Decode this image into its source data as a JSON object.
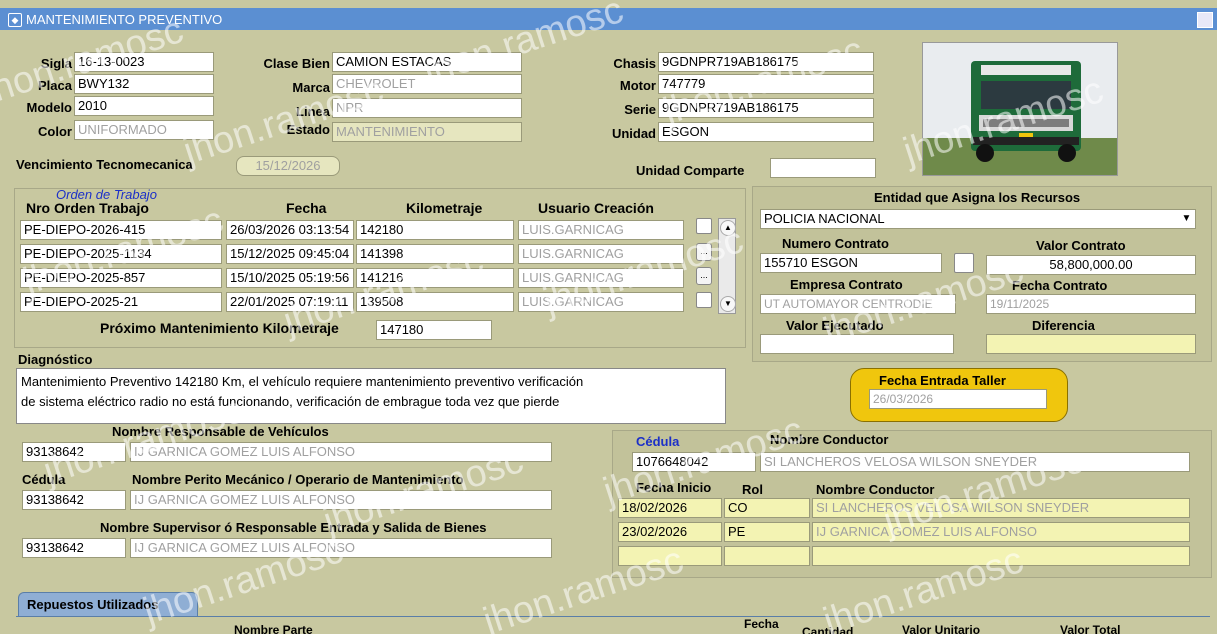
{
  "window": {
    "title": "MANTENIMIENTO PREVENTIVO"
  },
  "vehicle": {
    "sigla_label": "Sigla",
    "sigla": "16-13-0023",
    "placa_label": "Placa",
    "placa": "BWY132",
    "modelo_label": "Modelo",
    "modelo": "2010",
    "color_label": "Color",
    "color": "UNIFORMADO",
    "clase_label": "Clase Bien",
    "clase": "CAMION ESTACAS",
    "marca_label": "Marca",
    "marca": "CHEVROLET",
    "linea_label": "Linea",
    "linea": "NPR",
    "estado_label": "Estado",
    "estado": "MANTENIMIENTO",
    "chasis_label": "Chasis",
    "chasis": "9GDNPR719AB186175",
    "motor_label": "Motor",
    "motor": "747779",
    "serie_label": "Serie",
    "serie": "9GDNPR719AB186175",
    "unidad_label": "Unidad",
    "unidad": "ESGON",
    "tecno_label": "Vencimiento Tecnomecanica",
    "tecno": "15/12/2026",
    "comparte_label": "Unidad Comparte",
    "comparte": ""
  },
  "orders": {
    "section_title": "Orden de Trabajo",
    "headers": [
      "Nro Orden Trabajo",
      "Fecha",
      "Kilometraje",
      "Usuario Creación"
    ],
    "rows": [
      {
        "nro": "PE-DIEPO-2026-415",
        "fecha": "26/03/2026 03:13:54",
        "km": "142180",
        "usuario": "LUIS.GARNICAG"
      },
      {
        "nro": "PE-DIEPO-2025-1134",
        "fecha": "15/12/2025 09:45:04",
        "km": "141398",
        "usuario": "LUIS.GARNICAG"
      },
      {
        "nro": "PE-DIEPO-2025-857",
        "fecha": "15/10/2025 05:19:56",
        "km": "141216",
        "usuario": "LUIS.GARNICAG"
      },
      {
        "nro": "PE-DIEPO-2025-21",
        "fecha": "22/01/2025 07:19:11",
        "km": "139508",
        "usuario": "LUIS.GARNICAG"
      }
    ],
    "proximo_label": "Próximo Mantenimiento Kilometraje",
    "proximo": "147180"
  },
  "entidad": {
    "title": "Entidad que Asigna los Recursos",
    "value": "POLICIA NACIONAL",
    "numero_label": "Numero Contrato",
    "numero": "155710 ESGON",
    "valor_label": "Valor Contrato",
    "valor": "58,800,000.00",
    "empresa_label": "Empresa Contrato",
    "empresa": "UT AUTOMAYOR CENTRODIE",
    "fecha_label": "Fecha Contrato",
    "fecha": "19/11/2025",
    "ejecutado_label": "Valor Ejecutado",
    "ejecutado": "",
    "diferencia_label": "Diferencia",
    "diferencia": ""
  },
  "diagnostico": {
    "label": "Diagnóstico",
    "line1": "Mantenimiento Preventivo 142180 Km, el vehículo requiere mantenimiento preventivo verificación",
    "line2": "de sistema eléctrico radio no está funcionando, verificación de embrague toda vez que pierde"
  },
  "taller": {
    "label": "Fecha Entrada Taller",
    "value": "26/03/2026"
  },
  "responsables": {
    "resp_title": "Nombre Responsable de Vehículos",
    "resp_id": "93138642",
    "resp_name": "IJ GARNICA GOMEZ LUIS ALFONSO",
    "cedula_label": "Cédula",
    "perito_title": "Nombre Perito Mecánico / Operario de Mantenimiento",
    "perito_id": "93138642",
    "perito_name": "IJ GARNICA GOMEZ LUIS ALFONSO",
    "super_title": "Nombre Supervisor ó Responsable Entrada y Salida de Bienes",
    "super_id": "93138642",
    "super_name": "IJ GARNICA GOMEZ LUIS ALFONSO"
  },
  "conductor": {
    "cedula_label": "Cédula",
    "nombre_label": "Nombre Conductor",
    "cedula": "1076648042",
    "nombre": "SI LANCHEROS VELOSA WILSON SNEYDER",
    "hdr_inicio": "Fecha Inicio",
    "hdr_rol": "Rol",
    "hdr_nombre": "Nombre Conductor",
    "rows": [
      {
        "inicio": "18/02/2026",
        "rol": "CO",
        "nombre": "SI LANCHEROS VELOSA WILSON SNEYDER"
      },
      {
        "inicio": "23/02/2026",
        "rol": "PE",
        "nombre": "IJ GARNICA GOMEZ LUIS ALFONSO"
      },
      {
        "inicio": "",
        "rol": "",
        "nombre": ""
      }
    ]
  },
  "repuestos": {
    "tab": "Repuestos Utilizados",
    "col_nombre": "Nombre Parte",
    "col_fecha": "Fecha",
    "col_cantidad": "Cantidad",
    "col_valor": "Valor Unitario",
    "col_total": "Valor Total"
  },
  "watermark": "jhon.ramosc",
  "colors": {
    "background": "#c8c8a0",
    "titlebar": "#5b8fd2",
    "highlight": "#f0c60d"
  }
}
